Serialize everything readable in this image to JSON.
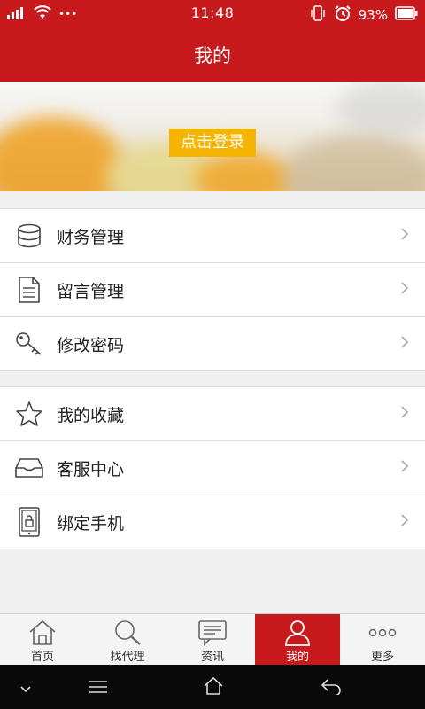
{
  "status": {
    "time": "11:48",
    "battery": "93%",
    "dots": "•••"
  },
  "header": {
    "title": "我的"
  },
  "banner": {
    "login_label": "点击登录"
  },
  "menu_groups": [
    [
      {
        "label": "财务管理",
        "icon": "database-icon"
      },
      {
        "label": "留言管理",
        "icon": "document-icon"
      },
      {
        "label": "修改密码",
        "icon": "key-icon"
      }
    ],
    [
      {
        "label": "我的收藏",
        "icon": "star-icon"
      },
      {
        "label": "客服中心",
        "icon": "inbox-icon"
      },
      {
        "label": "绑定手机",
        "icon": "phone-lock-icon"
      }
    ]
  ],
  "tabs": [
    {
      "label": "首页",
      "icon": "home-icon"
    },
    {
      "label": "找代理",
      "icon": "search-icon"
    },
    {
      "label": "资讯",
      "icon": "chat-icon"
    },
    {
      "label": "我的",
      "icon": "user-icon",
      "active": true
    },
    {
      "label": "更多",
      "icon": "more-icon"
    }
  ],
  "colors": {
    "brand": "#c8191c",
    "login_button": "#f5b400"
  }
}
